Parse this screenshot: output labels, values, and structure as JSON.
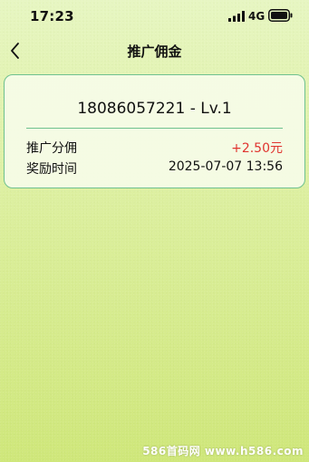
{
  "status_bar": {
    "time": "17:23",
    "network": "4G",
    "icons": [
      "signal-icon",
      "battery-icon"
    ]
  },
  "nav": {
    "title": "推广佣金",
    "back_icon": "back-chevron-icon"
  },
  "record": {
    "title": "18086057221 - Lv.1",
    "rows": [
      {
        "label": "推广分佣",
        "value": "+2.50元"
      },
      {
        "label": "奖励时间",
        "value": "2025-07-07 13:56"
      }
    ]
  },
  "watermark": "586首码网 www.h586.com",
  "colors": {
    "accent_border": "#6fc18f",
    "amount_red": "#e0342f",
    "background_top": "#e7f6c2",
    "background_bottom": "#cfe77a"
  }
}
